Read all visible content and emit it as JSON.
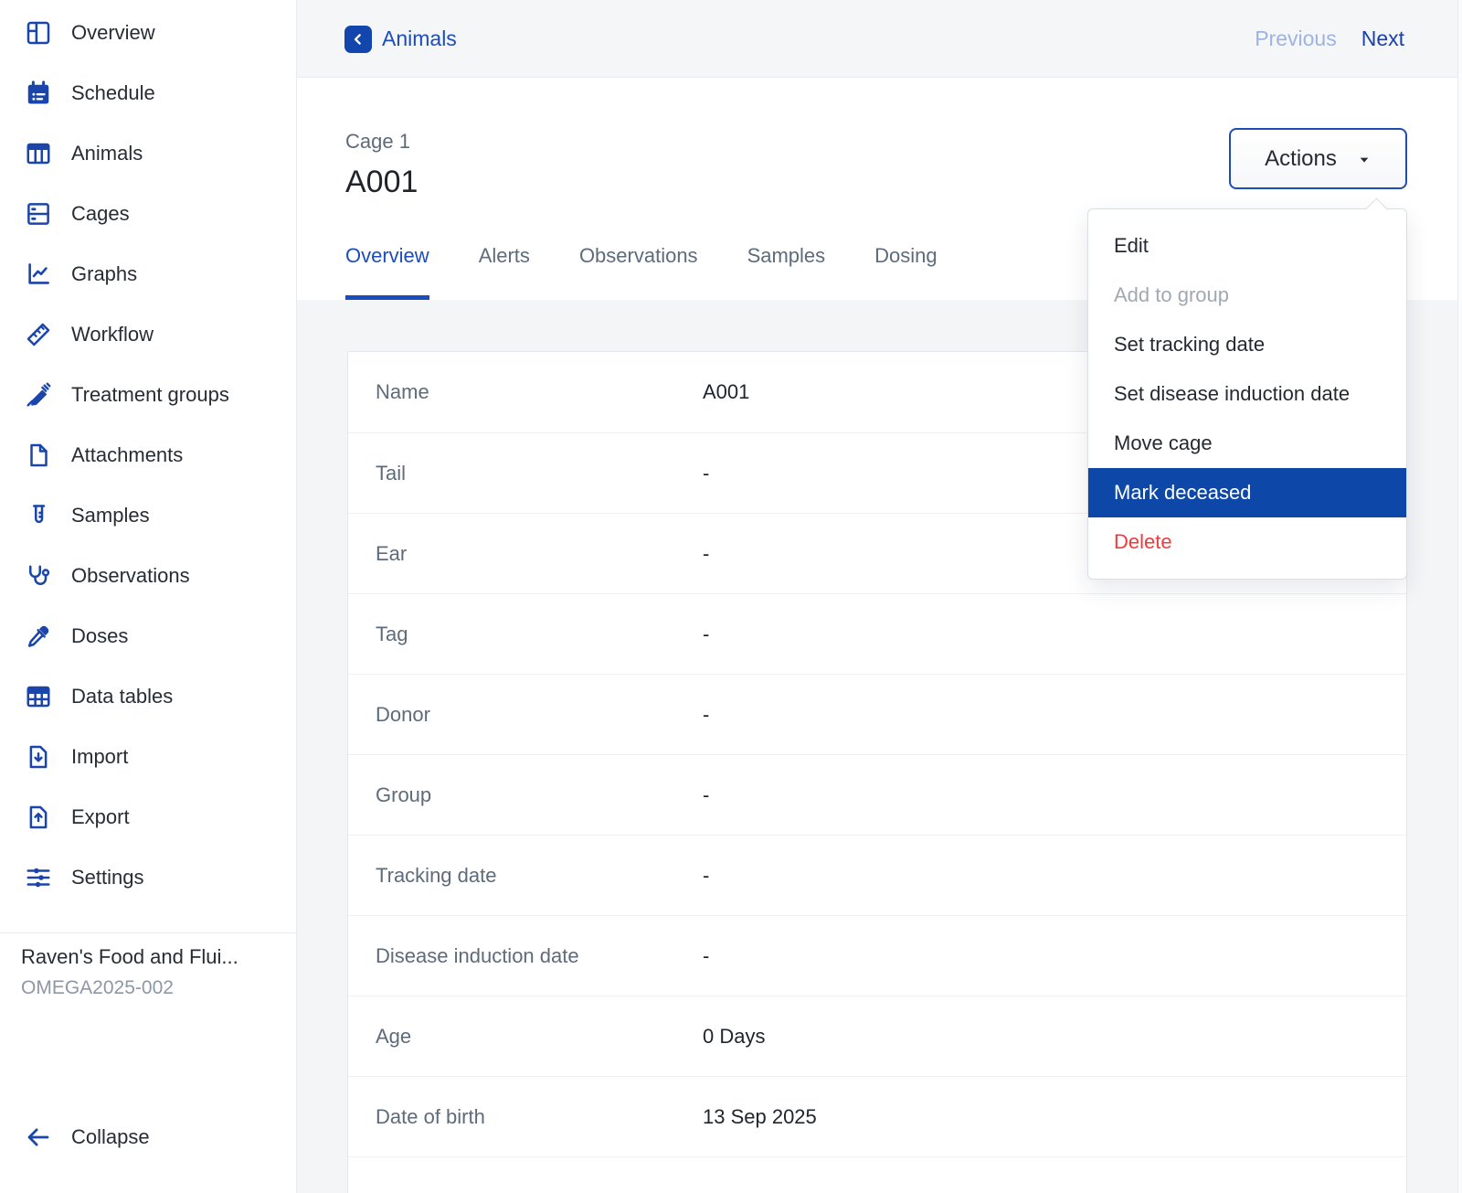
{
  "colors": {
    "accent": "#1d4cbb",
    "icon_blue": "#1a45ab",
    "selected_bg": "#0d47a8",
    "danger": "#f13a3a",
    "disabled_menu": "#a0a8b1",
    "previous_link": "#9fb3e2",
    "next_link": "#1b40ae",
    "back_btn": "#1246ad",
    "btn_border": "#1d4cb5"
  },
  "sidebar": {
    "items": [
      {
        "label": "Overview",
        "icon": "overview-icon"
      },
      {
        "label": "Schedule",
        "icon": "schedule-icon"
      },
      {
        "label": "Animals",
        "icon": "animals-icon"
      },
      {
        "label": "Cages",
        "icon": "cages-icon"
      },
      {
        "label": "Graphs",
        "icon": "graphs-icon"
      },
      {
        "label": "Workflow",
        "icon": "workflow-icon"
      },
      {
        "label": "Treatment groups",
        "icon": "treatment-groups-icon"
      },
      {
        "label": "Attachments",
        "icon": "attachments-icon"
      },
      {
        "label": "Samples",
        "icon": "samples-icon"
      },
      {
        "label": "Observations",
        "icon": "observations-icon"
      },
      {
        "label": "Doses",
        "icon": "doses-icon"
      },
      {
        "label": "Data tables",
        "icon": "data-tables-icon"
      },
      {
        "label": "Import",
        "icon": "import-icon"
      },
      {
        "label": "Export",
        "icon": "export-icon"
      },
      {
        "label": "Settings",
        "icon": "settings-icon"
      }
    ],
    "study_name": "Raven's Food and Flui...",
    "study_code": "OMEGA2025-002",
    "collapse_label": "Collapse"
  },
  "topbar": {
    "breadcrumb": "Animals",
    "previous_label": "Previous",
    "next_label": "Next"
  },
  "header": {
    "kicker": "Cage 1",
    "title": "A001",
    "actions_label": "Actions",
    "tabs": [
      {
        "label": "Overview",
        "active": true
      },
      {
        "label": "Alerts",
        "active": false
      },
      {
        "label": "Observations",
        "active": false
      },
      {
        "label": "Samples",
        "active": false
      },
      {
        "label": "Dosing",
        "active": false
      }
    ]
  },
  "actions_menu": {
    "items": [
      {
        "label": "Edit",
        "state": "normal"
      },
      {
        "label": "Add to group",
        "state": "disabled"
      },
      {
        "label": "Set tracking date",
        "state": "normal"
      },
      {
        "label": "Set disease induction date",
        "state": "normal"
      },
      {
        "label": "Move cage",
        "state": "normal"
      },
      {
        "label": "Mark deceased",
        "state": "selected"
      },
      {
        "label": "Delete",
        "state": "danger"
      }
    ]
  },
  "details": {
    "rows": [
      {
        "label": "Name",
        "value": "A001"
      },
      {
        "label": "Tail",
        "value": "-"
      },
      {
        "label": "Ear",
        "value": "-"
      },
      {
        "label": "Tag",
        "value": "-"
      },
      {
        "label": "Donor",
        "value": "-"
      },
      {
        "label": "Group",
        "value": "-"
      },
      {
        "label": "Tracking date",
        "value": "-"
      },
      {
        "label": "Disease induction date",
        "value": "-"
      },
      {
        "label": "Age",
        "value": "0 Days"
      },
      {
        "label": "Date of birth",
        "value": "13 Sep 2025"
      }
    ]
  }
}
